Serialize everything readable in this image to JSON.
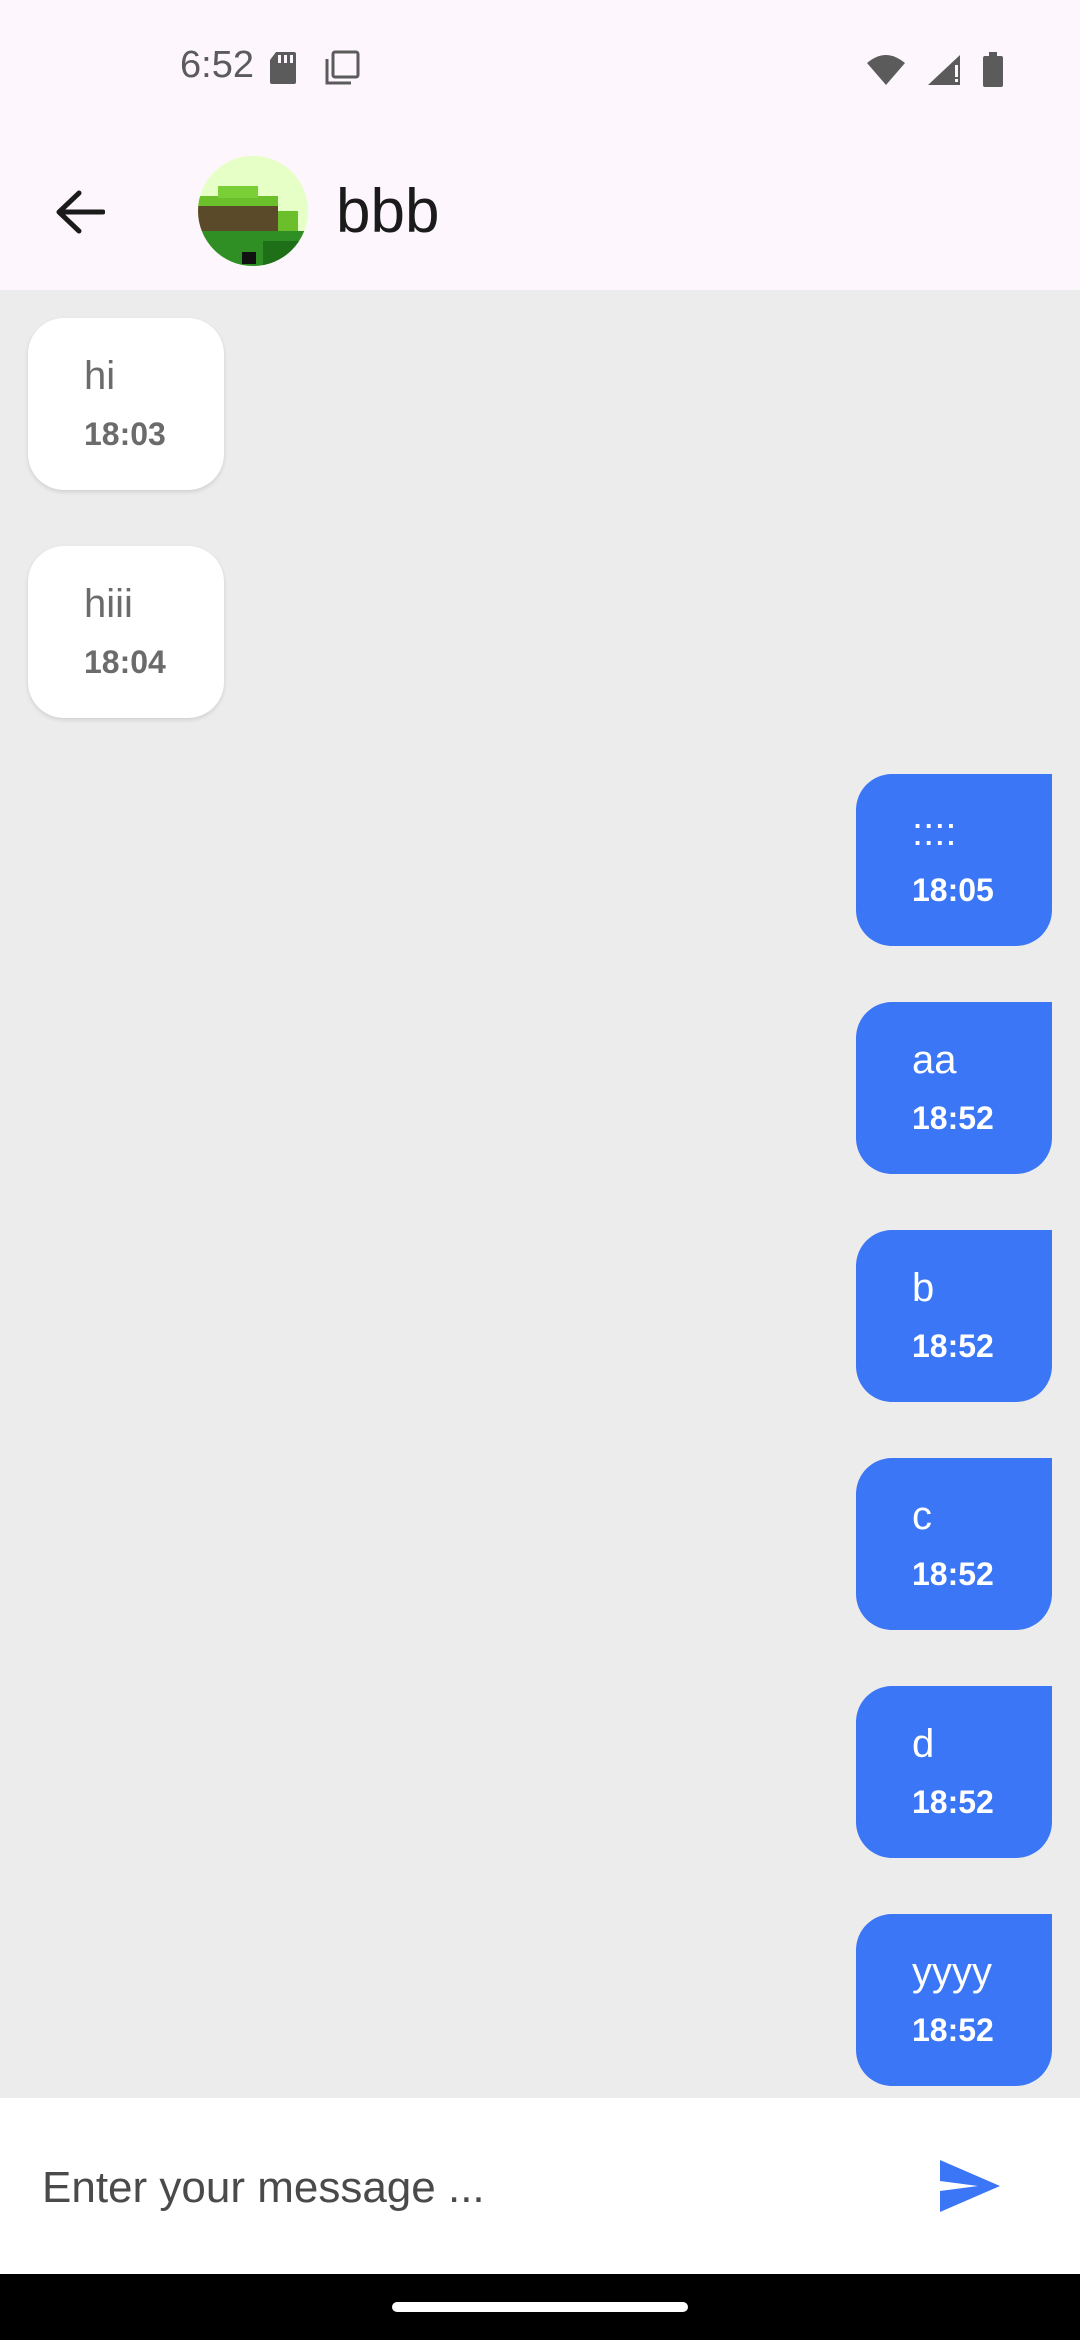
{
  "status_bar": {
    "time": "6:52",
    "icons_left": [
      "sd-card-icon",
      "screenshot-icon"
    ],
    "icons_right": [
      "wifi-icon",
      "signal-icon",
      "battery-icon"
    ]
  },
  "header": {
    "back_icon": "arrow-left-icon",
    "contact_name": "bbb",
    "avatar_icon": "avatar-image"
  },
  "messages": [
    {
      "direction": "incoming",
      "text": "hi",
      "time": "18:03"
    },
    {
      "direction": "incoming",
      "text": "hiii",
      "time": "18:04"
    },
    {
      "direction": "outgoing",
      "text": "::::",
      "time": "18:05"
    },
    {
      "direction": "outgoing",
      "text": "aa",
      "time": "18:52"
    },
    {
      "direction": "outgoing",
      "text": "b",
      "time": "18:52"
    },
    {
      "direction": "outgoing",
      "text": "c",
      "time": "18:52"
    },
    {
      "direction": "outgoing",
      "text": "d",
      "time": "18:52"
    },
    {
      "direction": "outgoing",
      "text": "yyyy",
      "time": "18:52"
    }
  ],
  "composer": {
    "placeholder": "Enter your message ...",
    "value": "",
    "send_icon": "send-icon"
  },
  "colors": {
    "outgoing_bubble": "#3b76f6",
    "incoming_bubble": "#ffffff",
    "chat_background": "#ececec",
    "header_background": "#fdf6fd"
  }
}
